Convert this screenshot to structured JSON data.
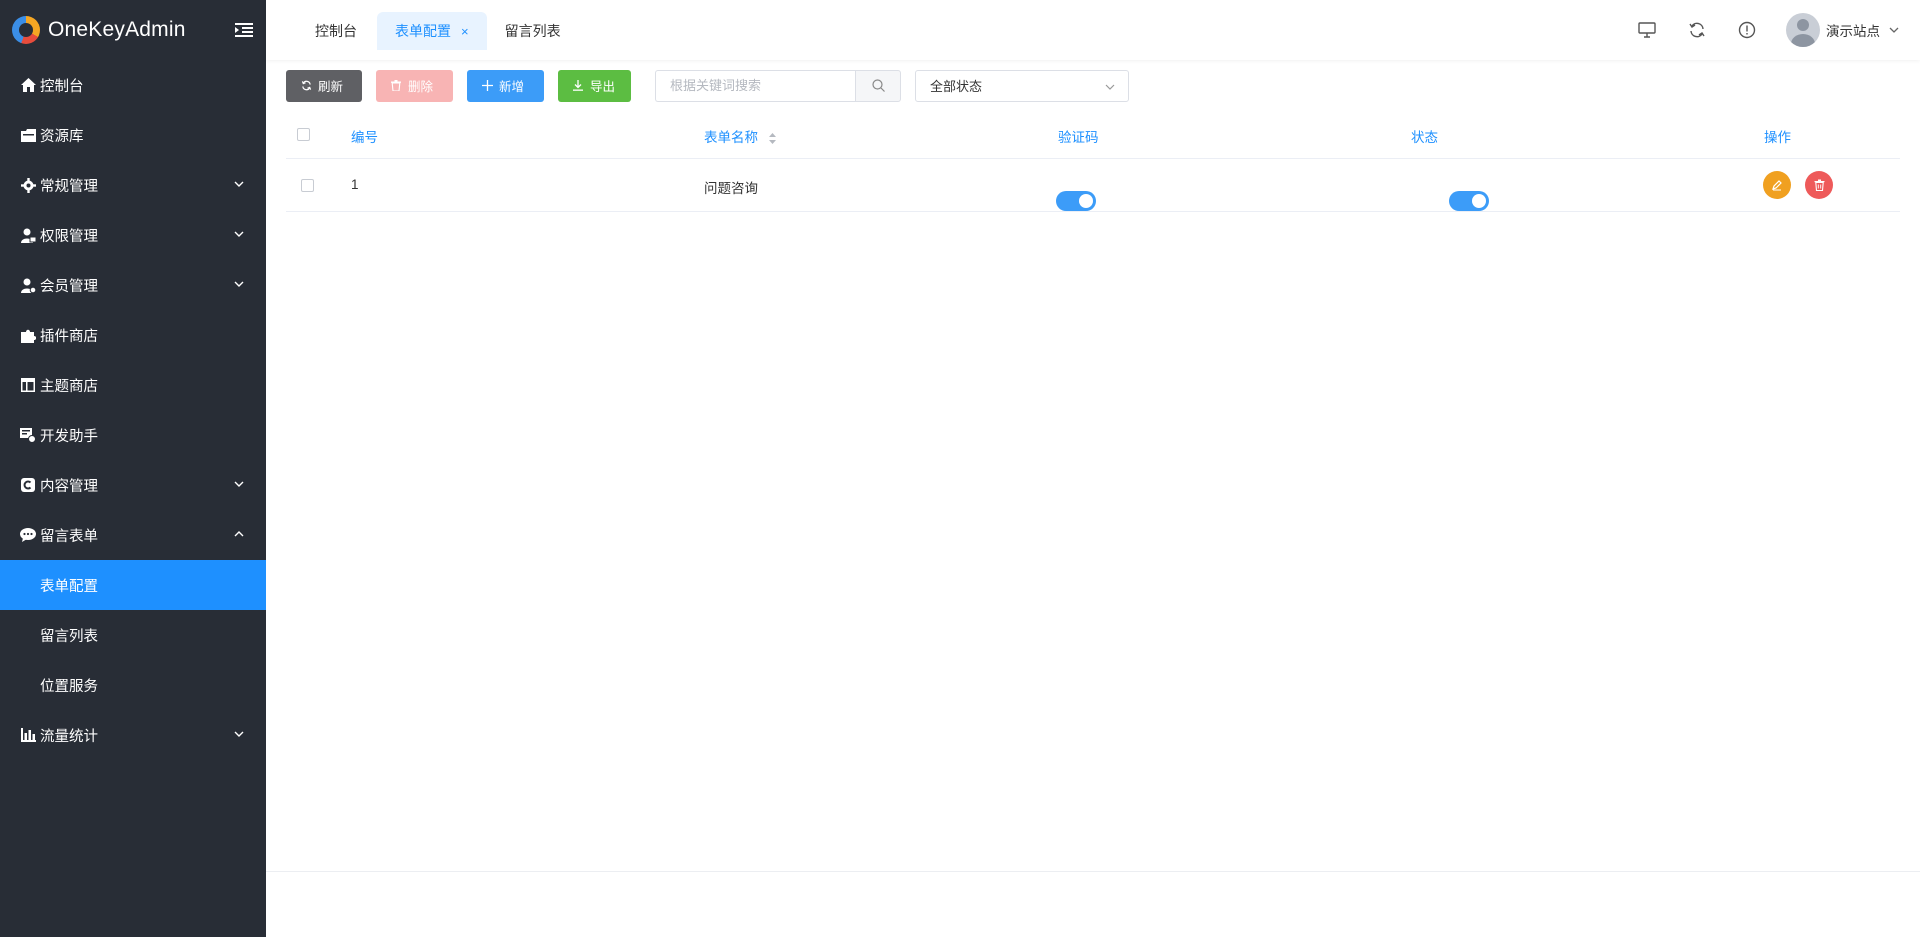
{
  "app": {
    "name": "OneKeyAdmin"
  },
  "sidebar": {
    "items": [
      {
        "label": "控制台",
        "icon": "home-icon"
      },
      {
        "label": "资源库",
        "icon": "folder-icon"
      },
      {
        "label": "常规管理",
        "icon": "gear-icon",
        "expandable": true
      },
      {
        "label": "权限管理",
        "icon": "user-lock-icon",
        "expandable": true
      },
      {
        "label": "会员管理",
        "icon": "user-icon",
        "expandable": true
      },
      {
        "label": "插件商店",
        "icon": "puzzle-icon"
      },
      {
        "label": "主题商店",
        "icon": "layout-icon"
      },
      {
        "label": "开发助手",
        "icon": "dev-icon"
      },
      {
        "label": "内容管理",
        "icon": "content-icon",
        "expandable": true
      },
      {
        "label": "留言表单",
        "icon": "chat-icon",
        "expanded": true
      },
      {
        "label": "流量统计",
        "icon": "bar-chart-icon",
        "expandable": true
      }
    ],
    "sub_items": [
      {
        "label": "表单配置",
        "active": true
      },
      {
        "label": "留言列表"
      },
      {
        "label": "位置服务"
      }
    ]
  },
  "header": {
    "tabs": [
      {
        "label": "控制台"
      },
      {
        "label": "表单配置",
        "active": true,
        "close": "×"
      },
      {
        "label": "留言列表"
      }
    ],
    "user_name": "演示站点"
  },
  "toolbar": {
    "refresh_label": "刷新",
    "delete_label": "删除",
    "add_label": "新增",
    "export_label": "导出",
    "search_placeholder": "根据关键词搜索",
    "status_select": "全部状态"
  },
  "table": {
    "columns": [
      "编号",
      "表单名称",
      "验证码",
      "状态",
      "操作"
    ],
    "rows": [
      {
        "id": "1",
        "name": "问题咨询",
        "captcha": true,
        "status": true
      }
    ]
  },
  "colors": {
    "sidebar_bg": "#282d36",
    "accent": "#1e90ff",
    "refresh_btn": "#5f6064",
    "delete_btn": "#f8b4b4",
    "add_btn": "#3c9cf8",
    "export_btn": "#5cbd42",
    "edit_action": "#f0a020",
    "delete_action": "#ee5a5a"
  }
}
